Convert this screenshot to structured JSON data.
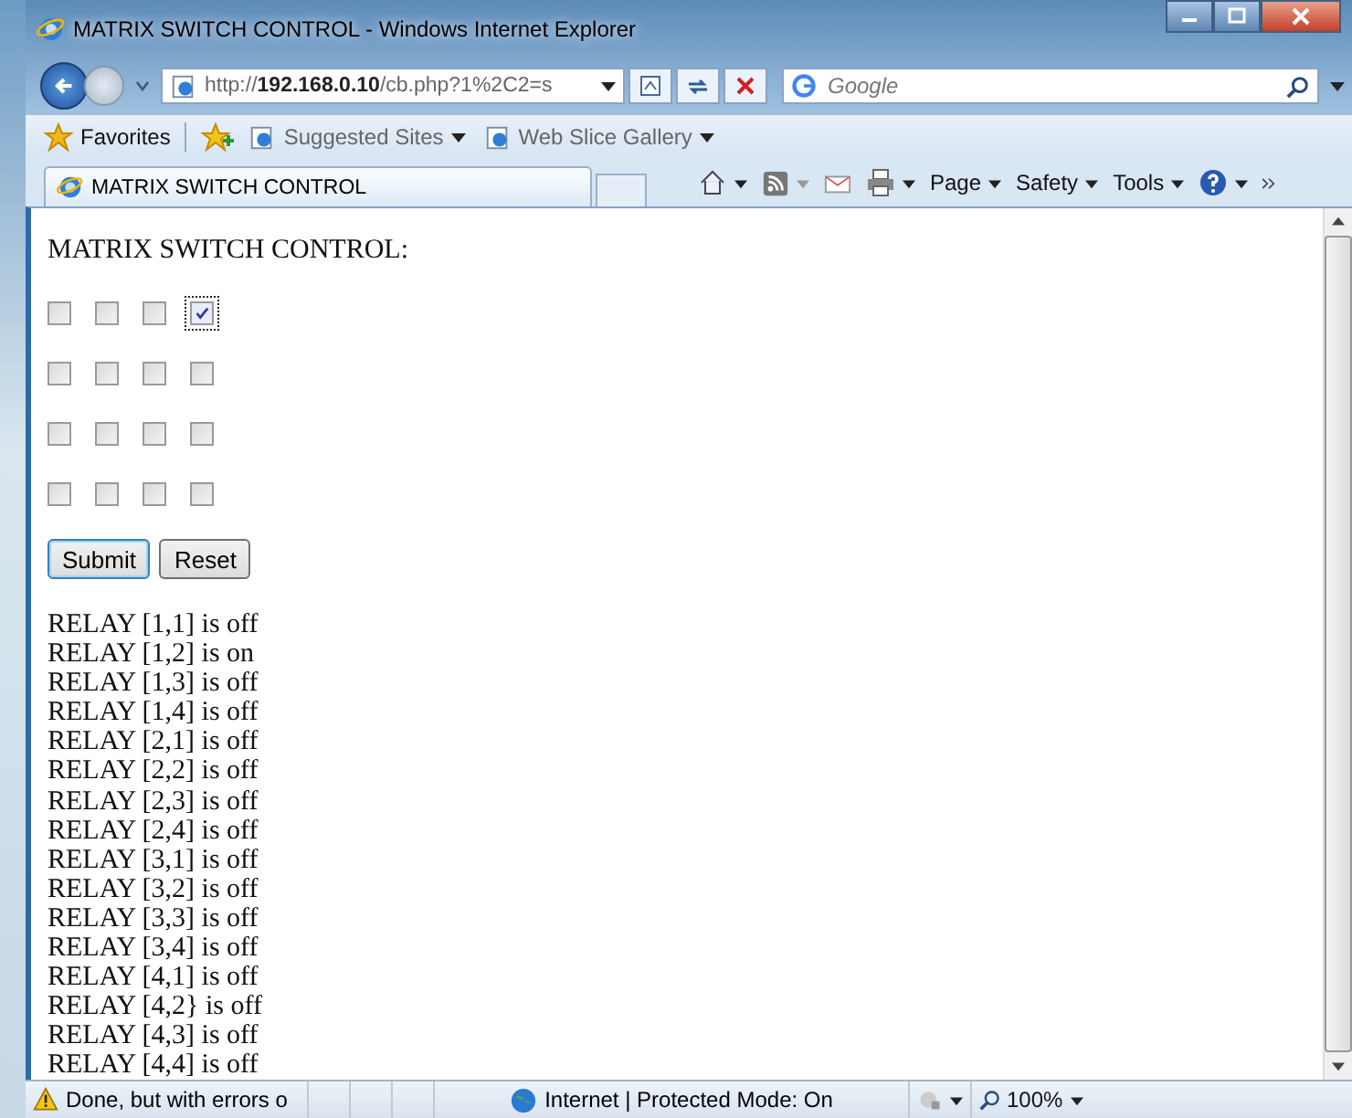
{
  "window": {
    "title": "MATRIX SWITCH CONTROL - Windows Internet Explorer"
  },
  "address_bar": {
    "url": "http://**192.168.0.10**/cb.php?1%2C2=s"
  },
  "search": {
    "placeholder": "Google"
  },
  "favorites_bar": {
    "items": [
      {
        "label": "Favorites",
        "kind": "favorites"
      },
      {
        "label": "Suggested Sites",
        "kind": "menu"
      },
      {
        "label": "Web Slice Gallery",
        "kind": "menu"
      }
    ]
  },
  "tab": {
    "label": "MATRIX SWITCH CONTROL"
  },
  "command_bar": {
    "items": [
      "Page",
      "Safety",
      "Tools"
    ]
  },
  "page": {
    "heading": "MATRIX SWITCH CONTROL:",
    "grid": [
      [
        {
          "checked": false,
          "focused": false
        },
        {
          "checked": false,
          "focused": false
        },
        {
          "checked": false,
          "focused": false
        },
        {
          "checked": true,
          "focused": true
        }
      ],
      [
        {
          "checked": false,
          "focused": false
        },
        {
          "checked": false,
          "focused": false
        },
        {
          "checked": false,
          "focused": false
        },
        {
          "checked": false,
          "focused": false
        }
      ],
      [
        {
          "checked": false,
          "focused": false
        },
        {
          "checked": false,
          "focused": false
        },
        {
          "checked": false,
          "focused": false
        },
        {
          "checked": false,
          "focused": false
        }
      ],
      [
        {
          "checked": false,
          "focused": false
        },
        {
          "checked": false,
          "focused": false
        },
        {
          "checked": false,
          "focused": false
        },
        {
          "checked": false,
          "focused": false
        }
      ]
    ],
    "buttons": [
      {
        "label": "Submit",
        "default": true
      },
      {
        "label": "Reset",
        "default": false
      }
    ],
    "relays": [
      "RELAY [1,1] is off",
      "RELAY [1,2] is on",
      "RELAY [1,3] is off",
      "RELAY [1,4] is off",
      "RELAY [2,1] is off",
      "RELAY [2,2] is off",
      "RELAY [2,3] is off",
      "RELAY [2,4] is off",
      "RELAY [3,1] is off",
      "RELAY [3,2] is off",
      "RELAY [3,3] is off",
      "RELAY [3,4] is off",
      "RELAY [4,1] is off",
      "RELAY [4,2} is off",
      "RELAY [4,3] is off",
      "RELAY [4,4] is off"
    ]
  },
  "status_bar": {
    "message": "Done, but with errors o",
    "zone": "Internet | Protected Mode: On",
    "zoom": "100%"
  }
}
